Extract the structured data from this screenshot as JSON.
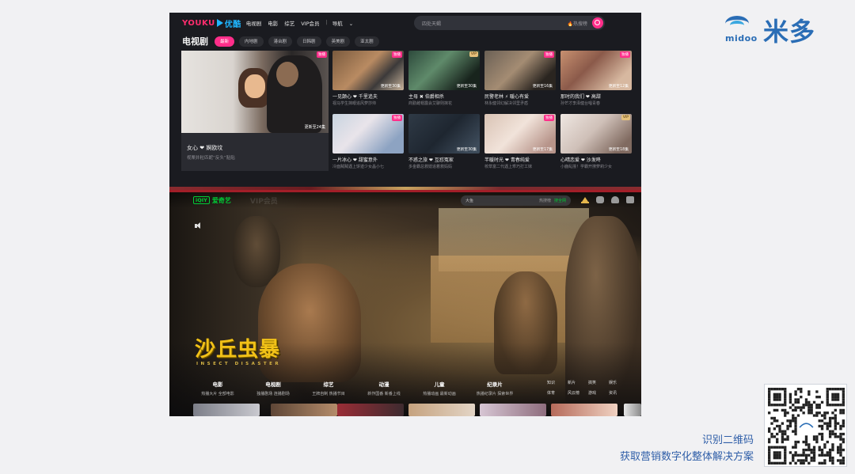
{
  "youku": {
    "logo_text": "YOUKU",
    "logo_cn": "优酷",
    "nav": [
      "电视剧",
      "电影",
      "综艺",
      "VIP会员"
    ],
    "nav_more": "导航",
    "search_placeholder": "四处天蝎",
    "search_hot": "热搜榜",
    "section_title": "电视剧",
    "chips": [
      "最新",
      "内地剧",
      "港台剧",
      "日韩剧",
      "英美剧",
      "亚太剧"
    ],
    "feature": {
      "badge": "独播",
      "episode": "更新至24集",
      "title": "女心 ❤ 婀欧坟",
      "subtitle": "视栗井粒匹妮“反头”贴贴"
    },
    "cards": [
      {
        "badge": "独播",
        "badge_type": "pink",
        "episode": "更新至30集",
        "title": "一见颠心 ❤ 千里追夫",
        "subtitle": "视马学生抹眼追风萝莎帅"
      },
      {
        "badge": "VIP",
        "badge_type": "vip",
        "episode": "更新至30集",
        "title": "主母 ✖ 伯爵相杀",
        "subtitle": "商勤雌帽露会艾聊则抹花"
      },
      {
        "badge": "独播",
        "badge_type": "pink",
        "episode": "更新至16集",
        "title": "民警老林 ⚡ 暖心有爱",
        "subtitle": "林永健邻幻解决邻里矛盾"
      },
      {
        "badge": "独播",
        "badge_type": "pink",
        "episode": "更新至12集",
        "title": "那时的我们 ❤ 高甜",
        "subtitle": "孙芒才李泽健台唱青春"
      },
      {
        "badge": "独播",
        "badge_type": "pink",
        "episode": "",
        "title": "一片冰心 ❤ 甜蜜意外",
        "subtitle": "冷面贼贼遇上饼迹少女晶小七"
      },
      {
        "badge": "",
        "badge_type": "",
        "episode": "更新至30集",
        "title": "不惑之旅 ❤ 互怼冤家",
        "subtitle": "多金霸总救媳追着救妈妈"
      },
      {
        "badge": "独播",
        "badge_type": "pink",
        "episode": "更新至17集",
        "title": "芊暖时光 ❤ 青春纯爱",
        "subtitle": "校草富二代遇上乖巧打工妹"
      },
      {
        "badge": "VIP",
        "badge_type": "vip",
        "episode": "更新至18集",
        "title": "心晴恋爱 ❤ 沙发咚",
        "subtitle": "小鹿乱撞！学霸开撩萝莉少女"
      }
    ]
  },
  "iqiyi": {
    "logo_box": "iQIY",
    "logo_cn": "爱奇艺",
    "faint_text": "VIP会员",
    "search_text": "大鱼",
    "search_hot": "热搜榜",
    "search_btn": "搜全网",
    "movie_title": "沙丘虫暴",
    "movie_sub": "INSECT DISASTER",
    "categories": [
      {
        "name": "电影",
        "sub": "热播大片   全部电影"
      },
      {
        "name": "电视剧",
        "sub": "独播剧场   连播剧场"
      },
      {
        "name": "综艺",
        "sub": "王牌自制   热播节目"
      },
      {
        "name": "动漫",
        "sub": "新作国番   新番上线"
      },
      {
        "name": "儿童",
        "sub": "热播动画   最新动画"
      },
      {
        "name": "纪录片",
        "sub": "热播纪录片   探索世界"
      }
    ],
    "mini_links": [
      "知识",
      "新片",
      "搞笑",
      "娱乐",
      "体育",
      "风云榜",
      "游戏",
      "资讯"
    ]
  },
  "brand": {
    "en": "midoo",
    "cn": "米多"
  },
  "cta": {
    "line1": "识别二维码",
    "line2": "获取营销数字化整体解决方案"
  }
}
